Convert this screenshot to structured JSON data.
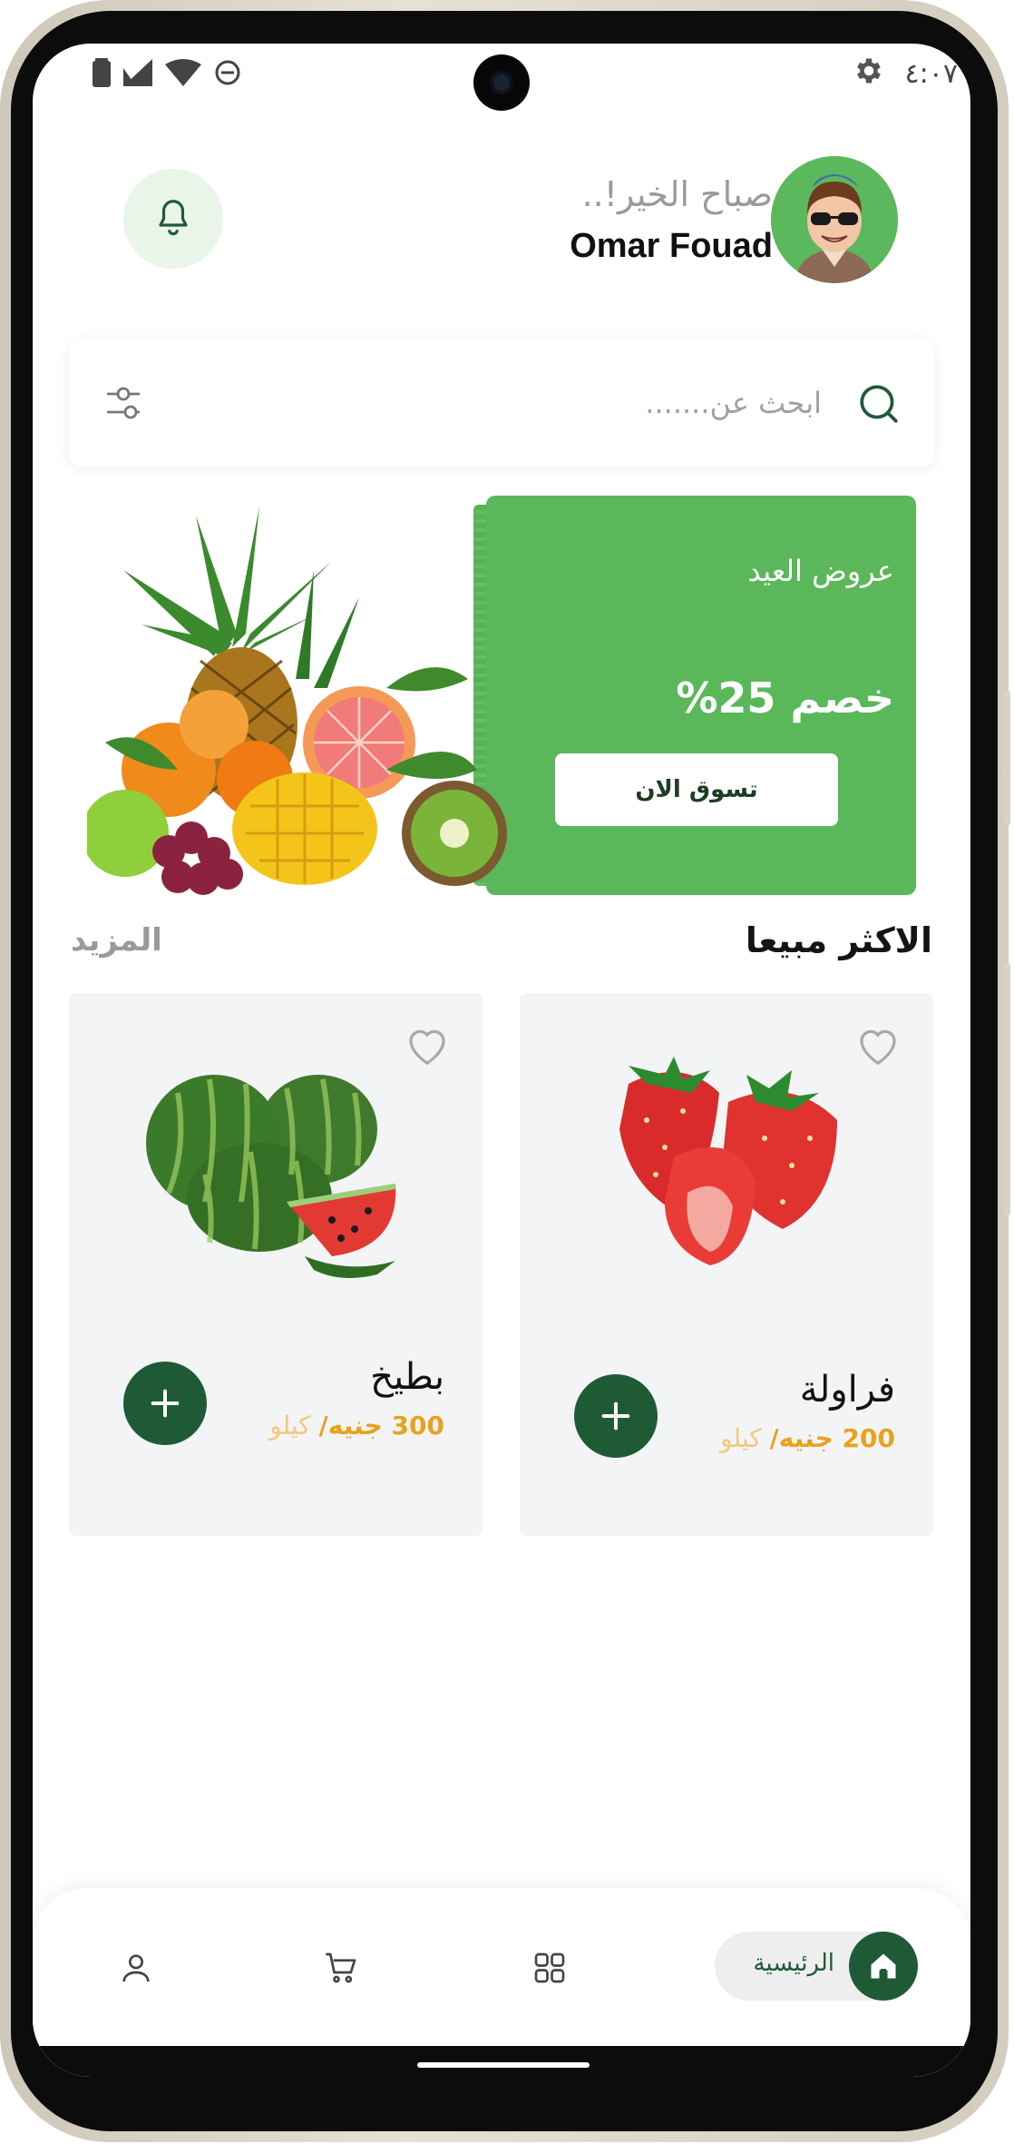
{
  "status_bar": {
    "time": "٤:٠٧"
  },
  "header": {
    "greeting": "صباح الخير!..",
    "username": "Omar Fouad"
  },
  "search": {
    "placeholder": "ابحث عن......."
  },
  "banner": {
    "title": "عروض العيد",
    "discount": "خصم 25%",
    "cta_label": "تسوق الان"
  },
  "best_sellers": {
    "title": "الاكثر مبيعا",
    "more_label": "المزيد",
    "products": [
      {
        "name": "فراولة",
        "price": "200 جنيه/",
        "unit": " كيلو"
      },
      {
        "name": "بطيخ",
        "price": "300 جنيه/",
        "unit": " كيلو"
      }
    ]
  },
  "bottom_nav": {
    "home_label": "الرئيسية",
    "items": [
      "home-icon",
      "grid-icon",
      "cart-icon",
      "profile-icon"
    ]
  },
  "colors": {
    "primary_green": "#5ab75a",
    "dark_green": "#1f5a36",
    "price_orange": "#e8a21c"
  }
}
